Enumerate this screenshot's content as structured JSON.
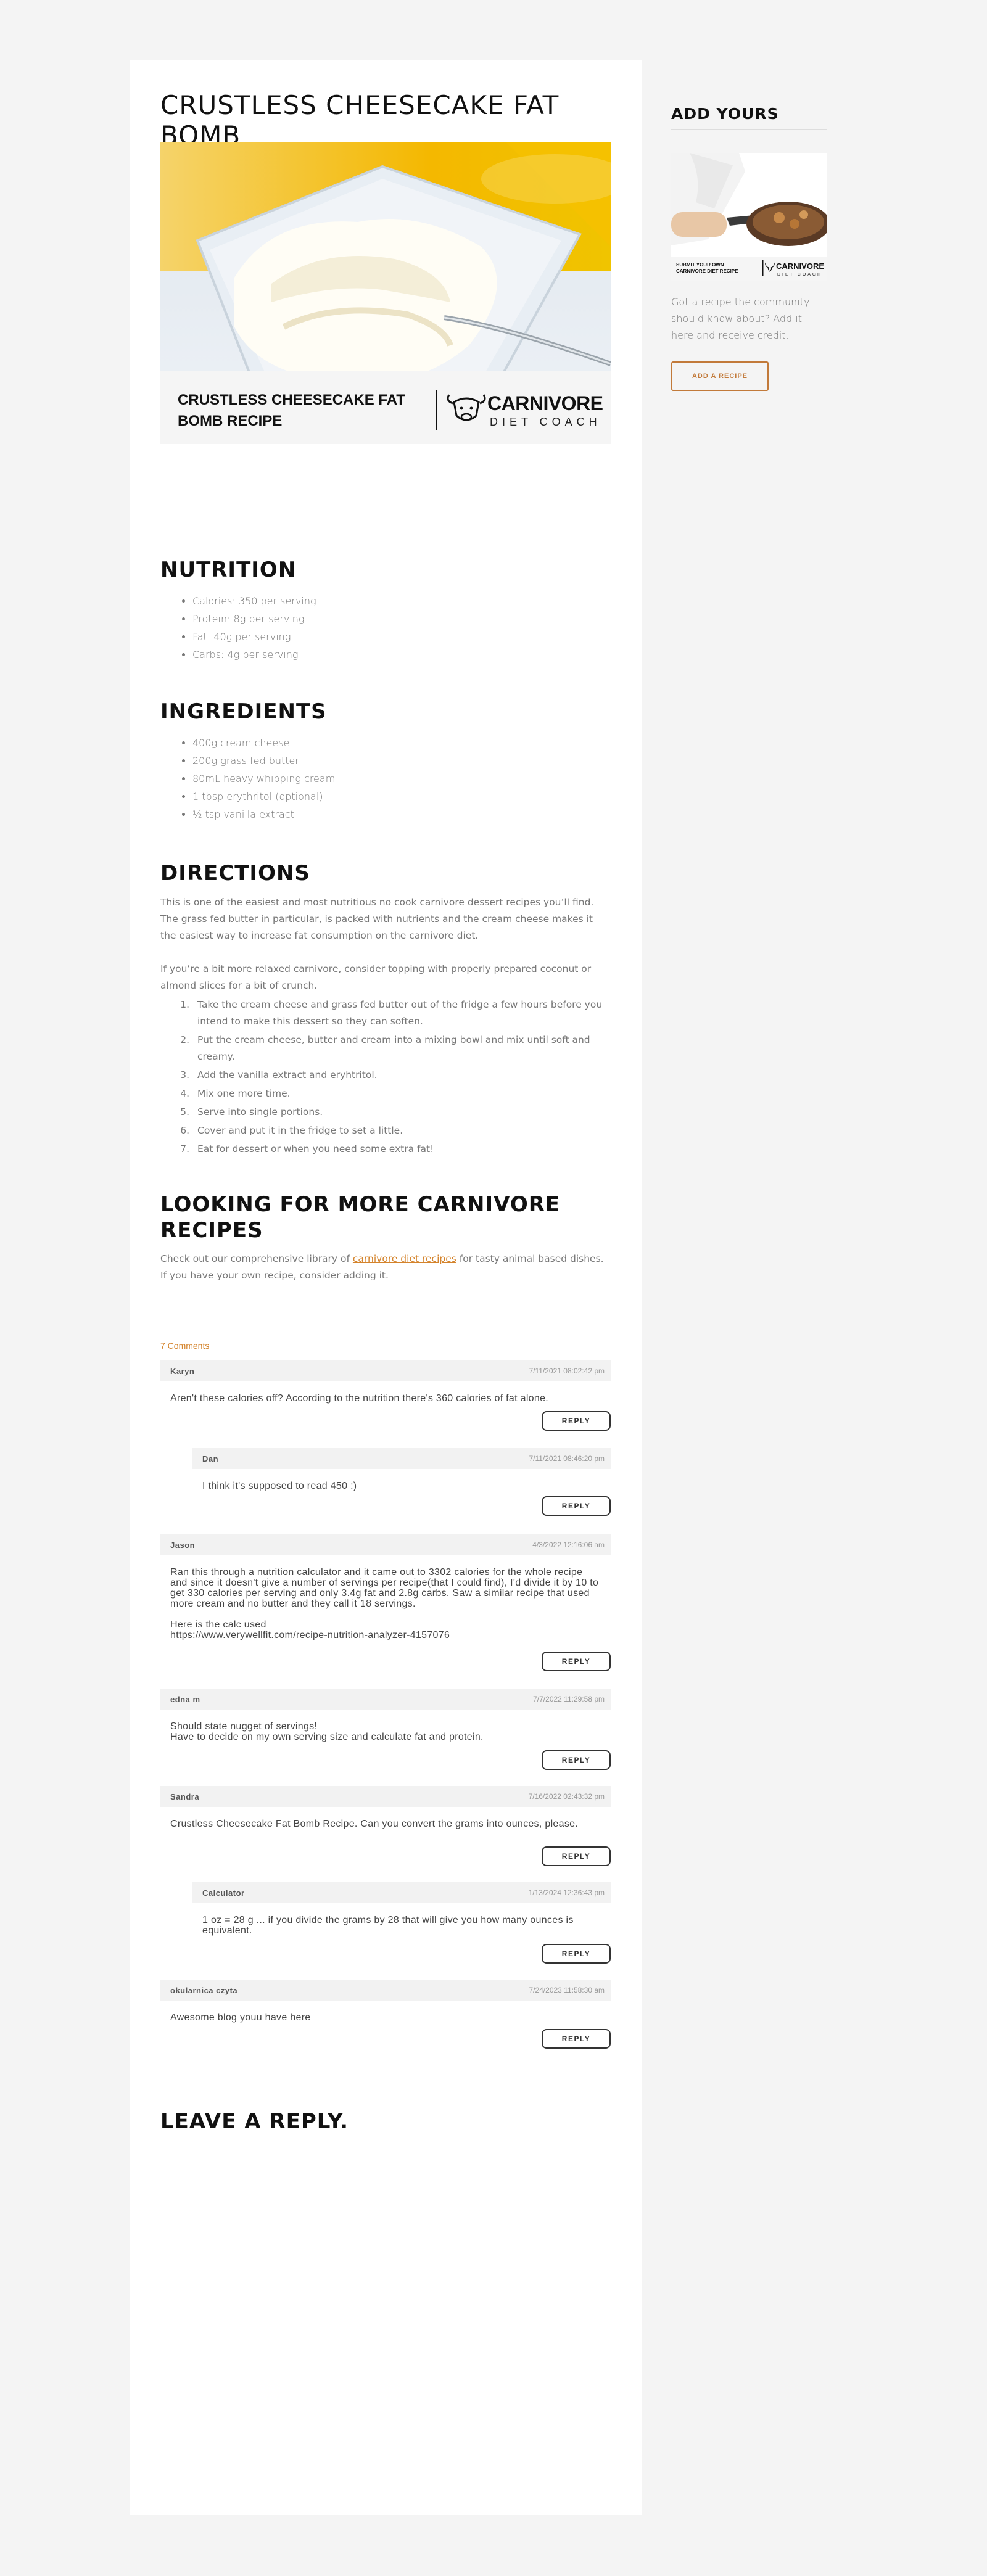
{
  "post": {
    "title": "CRUSTLESS CHEESECAKE FAT BOMB",
    "banner_text": "CRUSTLESS CHEESECAKE FAT BOMB RECIPE",
    "logo_main": "CARNIVORE",
    "logo_sub": "DIET COACH"
  },
  "nutrition": {
    "heading": "NUTRITION",
    "items": [
      "Calories: 350 per serving",
      "Protein: 8g per serving",
      "Fat: 40g per serving",
      "Carbs: 4g per serving"
    ]
  },
  "ingredients": {
    "heading": "INGREDIENTS",
    "items": [
      "400g cream cheese",
      "200g grass fed butter",
      "80mL heavy whipping cream",
      "1 tbsp erythritol (optional)",
      "½ tsp vanilla extract"
    ]
  },
  "directions": {
    "heading": "DIRECTIONS",
    "intro1": "This is one of the easiest and most nutritious no cook carnivore dessert recipes you’ll find. The grass fed butter in particular, is packed with nutrients and the cream cheese makes it the easiest way to increase fat consumption on the carnivore diet.",
    "intro2": "If you’re a bit more relaxed carnivore, consider topping with properly prepared coconut or almond slices for a bit of crunch.",
    "steps": [
      "Take the cream cheese and grass fed butter out of the fridge a few hours before you intend to make this dessert so they can soften.",
      "Put the cream cheese, butter and cream into a mixing bowl and mix until soft and creamy.",
      "Add the vanilla extract and eryhtritol.",
      "Mix one more time.",
      "Serve into single portions.",
      "Cover and put it in the fridge to set a little.",
      "Eat for dessert or when you need some extra fat!"
    ]
  },
  "more": {
    "heading": "LOOKING FOR MORE CARNIVORE RECIPES",
    "text_before": "Check out our comprehensive library of ",
    "link": "carnivore diet recipes",
    "text_after": " for tasty animal based dishes. If you have your own recipe, consider adding it."
  },
  "comments": {
    "count_label": "7 Comments",
    "reply_label": "REPLY",
    "items": [
      {
        "author": "Karyn",
        "date": "7/11/2021 08:02:42 pm",
        "body": "Aren't these calories off? According to the nutrition there's 360 calories of fat alone."
      },
      {
        "author": "Dan",
        "date": "7/11/2021 08:46:20 pm",
        "body": "I think it's supposed to read 450 :)"
      },
      {
        "author": "Jason",
        "date": "4/3/2022 12:16:06 am",
        "body": "Ran this through a nutrition calculator and it came out to 3302 calories for the whole recipe and since it doesn't give a number of servings per recipe(that I could find), I'd divide it by 10 to get 330 calories per serving and only 3.4g fat and 2.8g carbs. Saw a similar recipe that used more cream and no butter and they call it 18 servings.\n\nHere is the calc used\nhttps://www.verywellfit.com/recipe-nutrition-analyzer-4157076"
      },
      {
        "author": "edna m",
        "date": "7/7/2022 11:29:58 pm",
        "body": "Should state nugget of servings!\nHave to decide on my own serving size and calculate fat and protein."
      },
      {
        "author": "Sandra",
        "date": "7/16/2022 02:43:32 pm",
        "body": "Crustless Cheesecake Fat Bomb Recipe. Can you convert the grams into ounces, please."
      },
      {
        "author": "Calculator",
        "date": "1/13/2024 12:36:43 pm",
        "body": "1 oz = 28 g ... if you divide the grams by 28 that will give you how many ounces is equivalent."
      },
      {
        "author": "okularnica czyta",
        "date": "7/24/2023 11:58:30 am",
        "body": "Awesome blog youu have here"
      }
    ]
  },
  "leave_reply": "LEAVE A REPLY.",
  "sidebar": {
    "heading": "ADD YOURS",
    "img_text": "SUBMIT YOUR OWN CARNIVORE DIET RECIPE",
    "img_logo_main": "CARNIVORE",
    "img_logo_sub": "DIET COACH",
    "caption": "Got a recipe the community should know about? Add it here and receive credit.",
    "button": "ADD A RECIPE"
  },
  "colors": {
    "accent": "#d4832b",
    "background": "#f4f4f4",
    "card": "#ffffff"
  }
}
